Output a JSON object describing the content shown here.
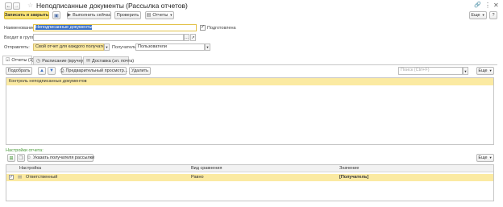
{
  "window": {
    "title": "Неподписанные документы (Рассылка отчетов)",
    "star_icon": "star-icon",
    "link_icon": "link-icon",
    "more_icon": "vertical-dots-icon",
    "close_icon": "close-icon"
  },
  "toolbar": {
    "save_close_label": "Записать и закрыть",
    "run_now_label": "Выполнить сейчас",
    "check_label": "Проверить",
    "reports_label": "Отчеты",
    "more_label": "Еще",
    "help_label": "?"
  },
  "form": {
    "name_label": "Наименование:",
    "name_value": "Неподписанные документы",
    "prepared_label": "Подготовлена",
    "group_label": "Входит в группу:",
    "group_value": "",
    "send_label": "Отправлять:",
    "send_value": "Свой отчет для каждого получателя",
    "recipients_label": "Получатели:",
    "recipients_value": "Пользователи"
  },
  "tabs": [
    {
      "label": "Отчеты (1)"
    },
    {
      "label": "Расписание (вручную)"
    },
    {
      "label": "Доставка (эл. почта)"
    }
  ],
  "reports_toolbar": {
    "pick_label": "Подобрать",
    "preview_label": "Предварительный просмотр...",
    "delete_label": "Удалить",
    "search_placeholder": "Поиск (Ctrl+F)",
    "more_label": "Еще"
  },
  "reports_list": [
    {
      "name": "Контроль неподписанных документов"
    }
  ],
  "settings": {
    "section_label": "Настройки отчета:",
    "specify_recipients_label": "Указать получателя рассылки",
    "more_label": "Еще",
    "columns": [
      "Настройка",
      "Вид сравнения",
      "Значение"
    ],
    "rows": [
      {
        "setting": "Ответственный",
        "comparison": "Равно",
        "value": "[Получатель]",
        "checked": true
      }
    ]
  },
  "colors": {
    "accent_yellow": "#fbe574",
    "row_highlight": "#fbeaa2",
    "green": "#4a9b3a"
  }
}
